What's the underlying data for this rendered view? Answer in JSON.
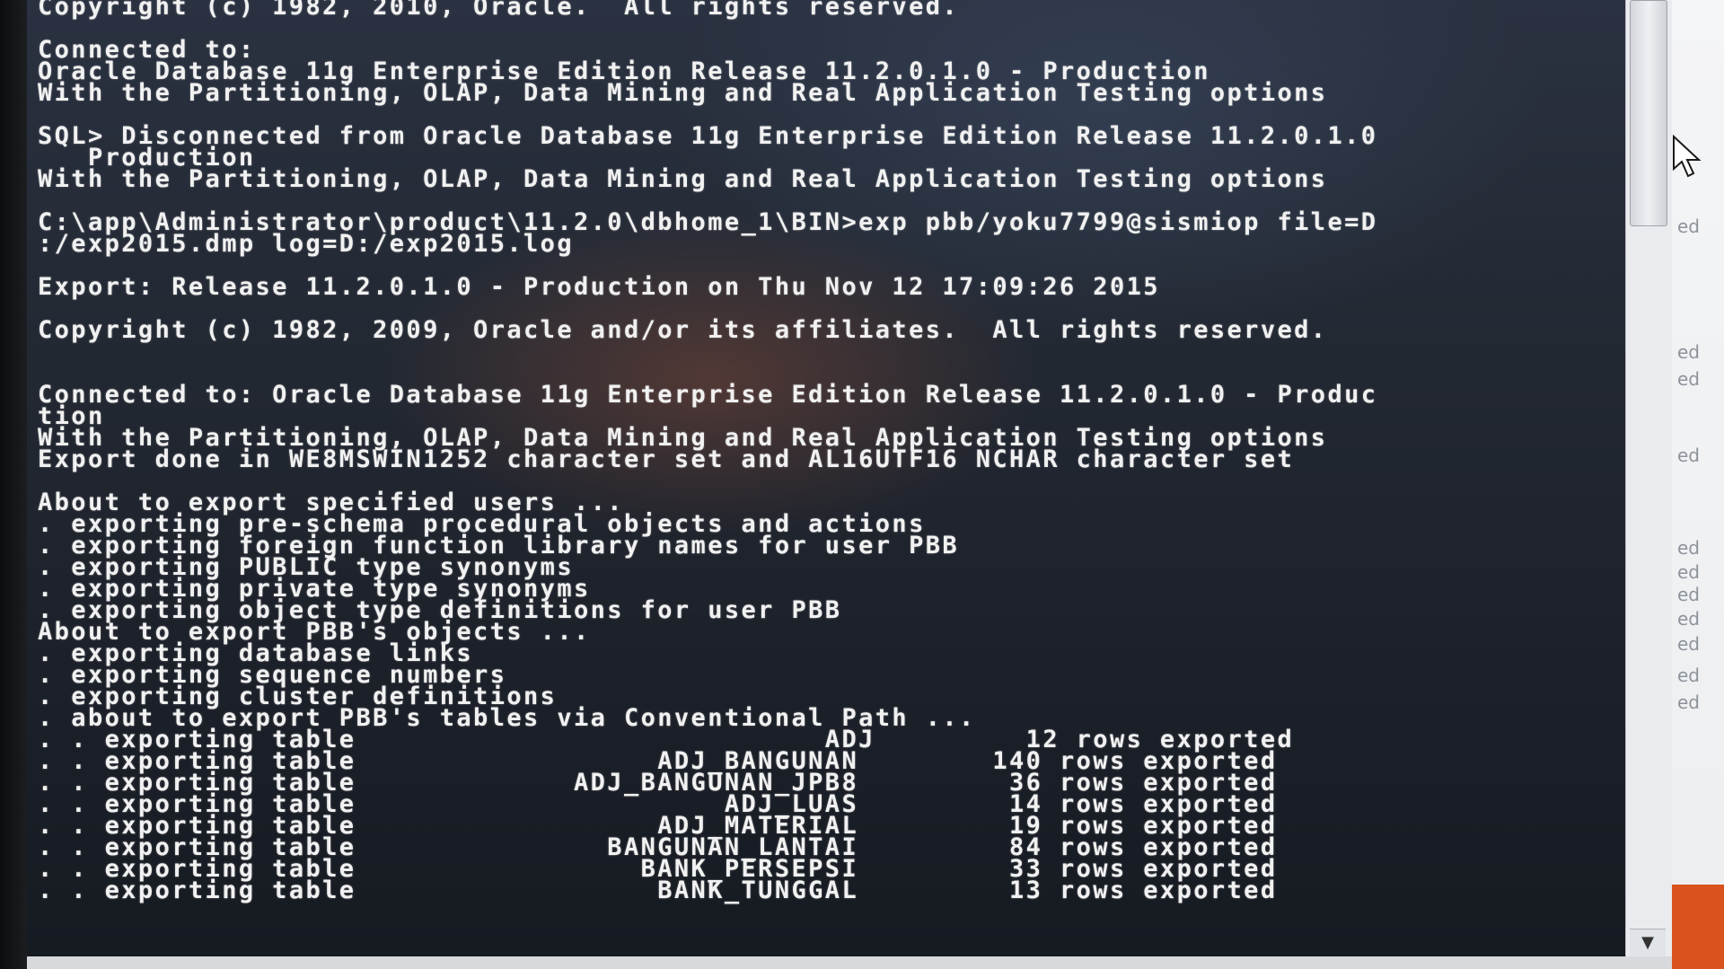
{
  "console": {
    "lines": [
      "Copyright (c) 1982, 2010, Oracle.  All rights reserved.",
      "",
      "Connected to:",
      "Oracle Database 11g Enterprise Edition Release 11.2.0.1.0 - Production",
      "With the Partitioning, OLAP, Data Mining and Real Application Testing options",
      "",
      "SQL> Disconnected from Oracle Database 11g Enterprise Edition Release 11.2.0.1.0",
      "   Production",
      "With the Partitioning, OLAP, Data Mining and Real Application Testing options",
      "",
      "C:\\app\\Administrator\\product\\11.2.0\\dbhome_1\\BIN>exp pbb/yoku7799@sismiop file=D",
      ":/exp2015.dmp log=D:/exp2015.log",
      "",
      "Export: Release 11.2.0.1.0 - Production on Thu Nov 12 17:09:26 2015",
      "",
      "Copyright (c) 1982, 2009, Oracle and/or its affiliates.  All rights reserved.",
      "",
      "",
      "Connected to: Oracle Database 11g Enterprise Edition Release 11.2.0.1.0 - Produc",
      "tion",
      "With the Partitioning, OLAP, Data Mining and Real Application Testing options",
      "Export done in WE8MSWIN1252 character set and AL16UTF16 NCHAR character set",
      "",
      "About to export specified users ...",
      ". exporting pre-schema procedural objects and actions",
      ". exporting foreign function library names for user PBB",
      ". exporting PUBLIC type synonyms",
      ". exporting private type synonyms",
      ". exporting object type definitions for user PBB",
      "About to export PBB's objects ...",
      ". exporting database links",
      ". exporting sequence numbers",
      ". exporting cluster definitions",
      ". about to export PBB's tables via Conventional Path ...",
      ". . exporting table                            ADJ         12 rows exported",
      ". . exporting table                  ADJ_BANGUNAN        140 rows exported",
      ". . exporting table             ADJ_BANGUNAN_JPB8         36 rows exported",
      ". . exporting table                      ADJ_LUAS         14 rows exported",
      ". . exporting table                  ADJ_MATERIAL         19 rows exported",
      ". . exporting table               BANGUNAN_LANTAI         84 rows exported",
      ". . exporting table                 BANK_PERSEPSI         33 rows exported",
      ". . exporting table                  BANK_TUNGGAL         13 rows exported"
    ]
  },
  "background_window": {
    "fragments": [
      "ed",
      "ed",
      "ed",
      "ed",
      "ed",
      "ed",
      "ed",
      "ed",
      "ed",
      "ed",
      "ed"
    ]
  },
  "icons": {
    "cursor": "mouse-pointer-icon",
    "scroll_down": "scroll-down-arrow-icon"
  },
  "colors": {
    "console_text": "#f1f1f1",
    "console_bg": "#1c2029",
    "accent_orange": "#d9531e"
  }
}
